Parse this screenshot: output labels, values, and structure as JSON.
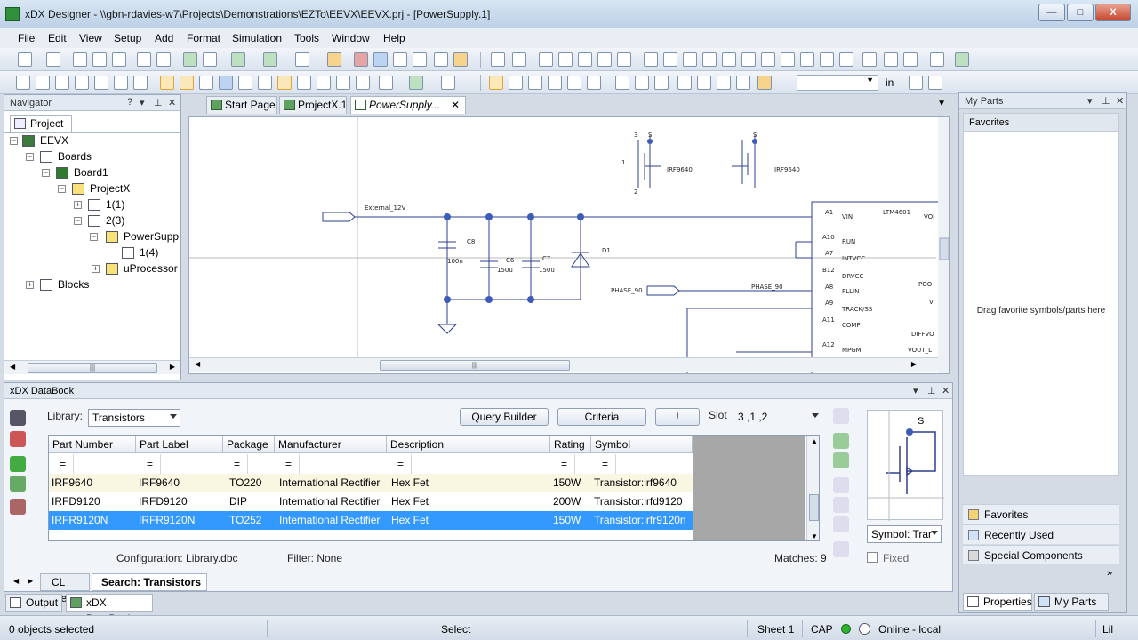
{
  "window": {
    "title": "xDX Designer - \\\\gbn-rdavies-w7\\Projects\\Demonstrations\\EZTo\\EEVX\\EEVX.prj - [PowerSupply.1]",
    "controls": {
      "minimize": "—",
      "maximize": "□",
      "close": "X"
    }
  },
  "menu": [
    "File",
    "Edit",
    "View",
    "Setup",
    "Add",
    "Format",
    "Simulation",
    "Tools",
    "Window",
    "Help"
  ],
  "toolbar": {
    "in_label": "in"
  },
  "navigator": {
    "title": "Navigator",
    "tab": "Project",
    "tree": [
      "EEVX",
      "Boards",
      "Board1",
      "ProjectX",
      "1(1)",
      "2(3)",
      "PowerSupp",
      "1(4)",
      "uProcessor",
      "Blocks"
    ]
  },
  "doc_tabs": [
    "Start Page",
    "ProjectX.1",
    "PowerSupply..."
  ],
  "schematic": {
    "net_ext": "External_12V",
    "net_phase_left": "PHASE_90",
    "net_phase_right": "PHASE_90",
    "c8": "C8",
    "c8_val": "100n",
    "c6": "C6",
    "c6_val": "150u",
    "c7": "C7",
    "c7_val": "150u",
    "d1": "D1",
    "q1": "IRF9640",
    "q2": "IRF9640",
    "pin_s1": "S",
    "pin_s2": "S",
    "pin_num3": "3",
    "pin_num1": "1",
    "pin_num2": "2",
    "ic_name": "LTM4601",
    "pins": [
      {
        "num": "A1",
        "name": "VIN"
      },
      {
        "num": "A10",
        "name": "RUN"
      },
      {
        "num": "A7",
        "name": "INTVCC"
      },
      {
        "num": "B12",
        "name": "DRVCC"
      },
      {
        "num": "A8",
        "name": "PLLIN"
      },
      {
        "num": "A9",
        "name": "TRACK/SS"
      },
      {
        "num": "A11",
        "name": "COMP"
      },
      {
        "num": "A12",
        "name": "MPGM"
      }
    ],
    "right_pins": [
      "VOI",
      "POO",
      "V",
      "DIFFVO",
      "VOUT_L"
    ]
  },
  "my_parts": {
    "title": "My Parts",
    "favorites_title": "Favorites",
    "hint": "Drag favorite symbols/parts here",
    "sections": [
      "Favorites",
      "Recently Used",
      "Special Components"
    ]
  },
  "databook": {
    "title": "xDX DataBook",
    "library_label": "Library:",
    "library_value": "Transistors",
    "query_builder": "Query Builder",
    "criteria": "Criteria",
    "bang": "!",
    "slot_label": "Slot",
    "slot_value": "3 ,1 ,2",
    "columns": [
      "Part Number",
      "Part Label",
      "Package",
      "Manufacturer",
      "Description",
      "Rating",
      "Symbol"
    ],
    "filter_row": [
      "=",
      "=",
      "=",
      "=",
      "=",
      "=",
      "="
    ],
    "rows": [
      [
        "IRF9640",
        "IRF9640",
        "TO220",
        "International Rectifier",
        "Hex Fet",
        "150W",
        "Transistor:irf9640"
      ],
      [
        "IRFD9120",
        "IRFD9120",
        "DIP",
        "International Rectifier",
        "Hex Fet",
        "200W",
        "Transistor:irfd9120"
      ],
      [
        "IRFR9120N",
        "IRFR9120N",
        "TO252",
        "International Rectifier",
        "Hex Fet",
        "150W",
        "Transistor:irfr9120n"
      ]
    ],
    "config": "Configuration: Library.dbc",
    "filter": "Filter: None",
    "matches": "Matches: 9",
    "symbol_select": "Symbol: Trar",
    "fixed": "Fixed",
    "preview_pin": "S",
    "tabs": [
      "CL View",
      "Search: Transistors"
    ]
  },
  "bottom_tabs": [
    "Output",
    "xDX DataBook"
  ],
  "right_bottom_tabs": [
    "Properties",
    "My Parts"
  ],
  "status": {
    "selected": "0 objects selected",
    "mode": "Select",
    "sheet": "Sheet 1",
    "caps": "CAP",
    "online": "Online - local",
    "lil": "Lil"
  },
  "colors": {
    "accent": "#3399ff",
    "wire": "#2d3f8f",
    "node": "#3d5bb8"
  }
}
